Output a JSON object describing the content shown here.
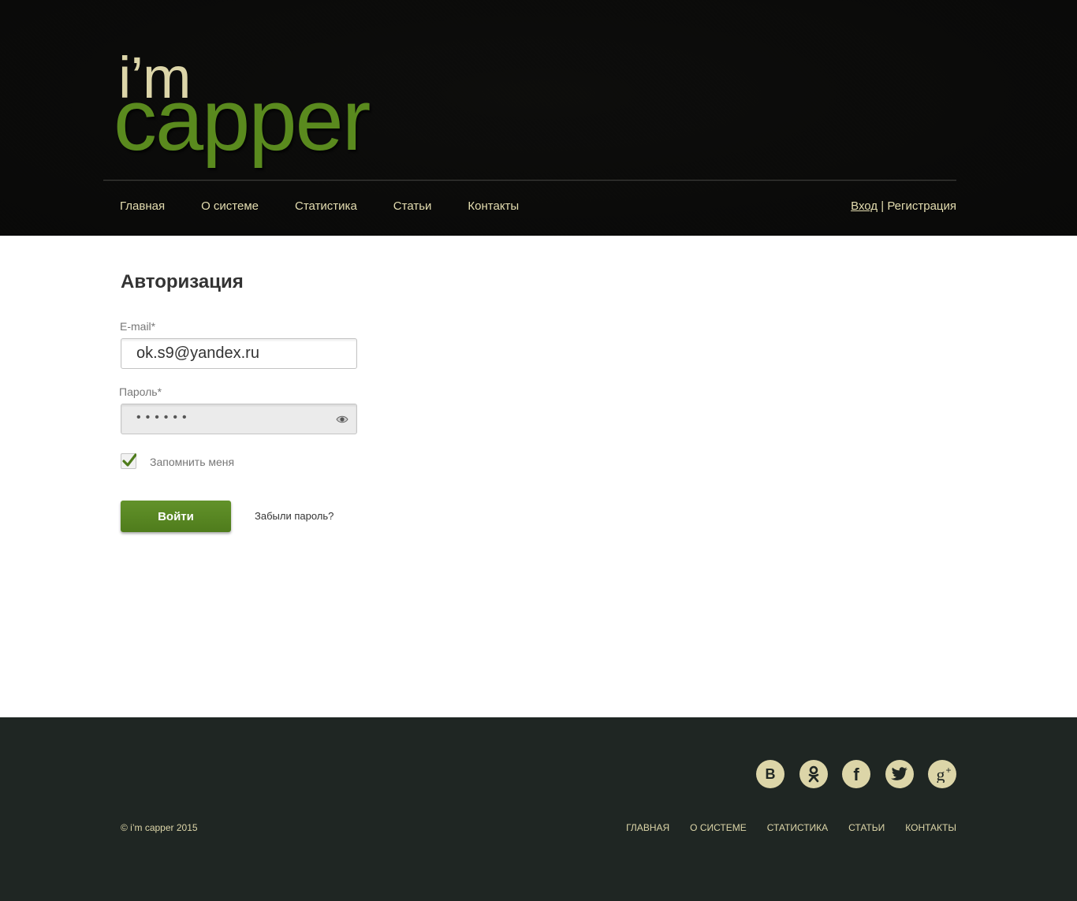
{
  "header": {
    "logo_top": "i’m",
    "logo_bottom": "capper",
    "nav": [
      "Главная",
      "О системе",
      "Статистика",
      "Статьи",
      "Контакты"
    ],
    "login_label": "Вход",
    "separator": "|",
    "register_label": "Регистрация"
  },
  "form": {
    "title": "Авторизация",
    "email_label": "E-mail*",
    "email_value": "ok.s9@yandex.ru",
    "password_label": "Пароль*",
    "password_mask": "••••••",
    "remember_label": "Запомнить меня",
    "remember_checked": true,
    "submit_label": "Войти",
    "forgot_label": "Забыли пароль?"
  },
  "footer": {
    "socials": [
      "vk-icon",
      "odnoklassniki-icon",
      "facebook-icon",
      "twitter-icon",
      "google-plus-icon"
    ],
    "copyright": "© i’m capper 2015",
    "nav": [
      "ГЛАВНАЯ",
      "О СИСТЕМЕ",
      "СТАТИСТИКА",
      "СТАТЬИ",
      "КОНТАКТЫ"
    ]
  },
  "colors": {
    "header_bg": "#262624",
    "accent_green": "#5a8a1e",
    "cream": "#dcd5a8",
    "footer_bg": "#1f2623"
  }
}
